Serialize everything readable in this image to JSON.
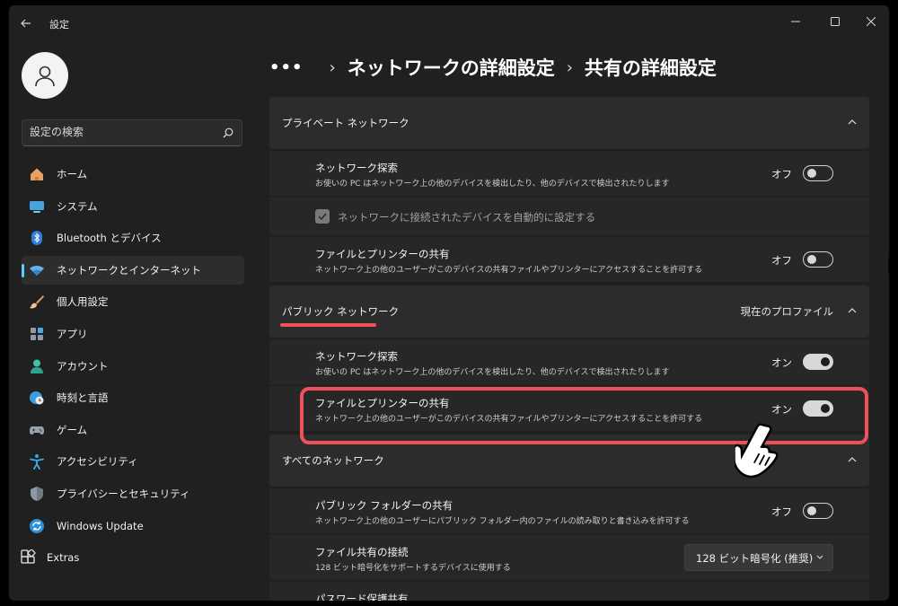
{
  "app": {
    "title": "設定"
  },
  "search": {
    "placeholder": "設定の検索"
  },
  "sidebar": {
    "items": [
      {
        "label": "ホーム",
        "icon": "home-icon"
      },
      {
        "label": "システム",
        "icon": "system-icon"
      },
      {
        "label": "Bluetooth とデバイス",
        "icon": "bluetooth-icon"
      },
      {
        "label": "ネットワークとインターネット",
        "icon": "wifi-icon",
        "selected": true
      },
      {
        "label": "個人用設定",
        "icon": "brush-icon"
      },
      {
        "label": "アプリ",
        "icon": "apps-icon"
      },
      {
        "label": "アカウント",
        "icon": "account-icon"
      },
      {
        "label": "時刻と言語",
        "icon": "globe-clock-icon"
      },
      {
        "label": "ゲーム",
        "icon": "gamepad-icon"
      },
      {
        "label": "アクセシビリティ",
        "icon": "accessibility-icon"
      },
      {
        "label": "プライバシーとセキュリティ",
        "icon": "shield-icon"
      },
      {
        "label": "Windows Update",
        "icon": "update-icon"
      },
      {
        "label": "Extras",
        "icon": "extras-icon"
      }
    ]
  },
  "breadcrumb": {
    "dots": "•••",
    "parent": "ネットワークの詳細設定",
    "current": "共有の詳細設定"
  },
  "private_section": {
    "title": "プライベート ネットワーク",
    "discovery": {
      "title": "ネットワーク探索",
      "desc": "お使いの PC はネットワーク上の他のデバイスを検出したり、他のデバイスで検出されたりします",
      "state": "オフ"
    },
    "auto_setup": {
      "label": "ネットワークに接続されたデバイスを自動的に設定する"
    },
    "sharing": {
      "title": "ファイルとプリンターの共有",
      "desc": "ネットワーク上の他のユーザーがこのデバイスの共有ファイルやプリンターにアクセスすることを許可する",
      "state": "オフ"
    }
  },
  "public_section": {
    "title": "パブリック ネットワーク",
    "profile_tag": "現在のプロファイル",
    "discovery": {
      "title": "ネットワーク探索",
      "desc": "お使いの PC はネットワーク上の他のデバイスを検出したり、他のデバイスで検出されたりします",
      "state": "オン"
    },
    "sharing": {
      "title": "ファイルとプリンターの共有",
      "desc": "ネットワーク上の他のユーザーがこのデバイスの共有ファイルやプリンターにアクセスすることを許可する",
      "state": "オン"
    }
  },
  "all_section": {
    "title": "すべてのネットワーク",
    "public_folder": {
      "title": "パブリック フォルダーの共有",
      "desc": "ネットワーク上の他のユーザーにパブリック フォルダー内のファイルの読み取りと書き込みを許可する",
      "state": "オフ"
    },
    "file_sharing_conn": {
      "title": "ファイル共有の接続",
      "desc": "128 ビット暗号化をサポートするデバイスに使用する",
      "value": "128 ビット暗号化 (推奨)"
    },
    "password_sharing": {
      "title": "パスワード保護共有"
    }
  },
  "colors": {
    "accent": "#60cdff",
    "highlight": "#f0505a"
  }
}
